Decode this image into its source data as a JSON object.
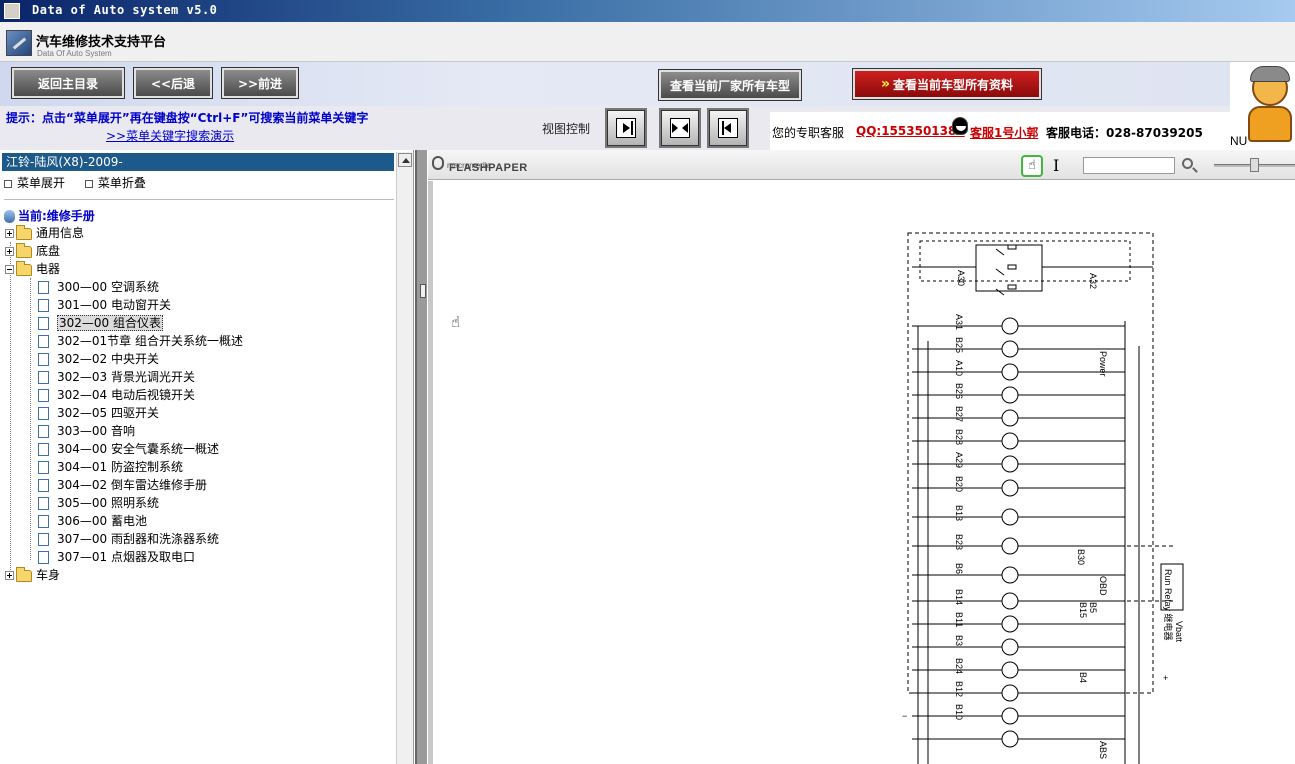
{
  "window": {
    "title": "Data of Auto system v5.0"
  },
  "app": {
    "name": "汽车维修技术支持平台",
    "subtitle": "Data Of Auto System"
  },
  "toolbar": {
    "home": "返回主目录",
    "back": "<<后退",
    "forward": ">>前进",
    "all_models": "查看当前厂家所有车型",
    "all_docs_arrows": "»",
    "all_docs": "查看当前车型所有资料"
  },
  "hint": {
    "text": "提示：点击“菜单展开”再在键盘按“Ctrl+F”可搜索当前菜单关键字",
    "link": ">>菜单关键字搜索演示"
  },
  "view_control": {
    "label": "视图控制"
  },
  "contact": {
    "intro": "您的专职客服",
    "qq": "QQ:1553501388",
    "agent": "客服1号小郭",
    "phone": "客服电话：028-87039205"
  },
  "mascot": {
    "text": "NU"
  },
  "sidebar": {
    "vehicle": "江铃-陆风(X8)-2009-",
    "expand": "菜单展开",
    "collapse": "菜单折叠",
    "current": "当前:维修手册",
    "tree": [
      {
        "label": "通用信息",
        "expanded": false
      },
      {
        "label": "底盘",
        "expanded": false
      },
      {
        "label": "电器",
        "expanded": true
      },
      {
        "label": "车身",
        "expanded": false
      }
    ],
    "electrical_items": [
      "300—00 空调系统",
      "301—00 电动窗开关",
      "302—00 组合仪表",
      "302—01节章  组合开关系统一概述",
      "302—02 中央开关",
      "302—03 背景光调光开关",
      "302—04 电动后视镜开关",
      "302—05 四驱开关",
      "303—00 音响",
      "304—00 安全气囊系统一概述",
      "304—01 防盗控制系统",
      "304—02 倒车雷达维修手册",
      "305—00 照明系统",
      "306—00 蓄电池",
      "307—00 雨刮器和洗涤器系统",
      "307—01 点烟器及取电口"
    ],
    "selected_index": 2
  },
  "viewer": {
    "brand_top": "macromedia",
    "brand_bottom": "FLASHPAPER",
    "hand_icon": "hand-tool-icon",
    "text_cursor_icon": "text-select-icon",
    "search_value": ""
  },
  "diagram": {
    "pins_left": [
      "A30",
      "A31",
      "B25",
      "A10",
      "B26",
      "B27",
      "B28",
      "A29",
      "B20",
      "B13",
      "B23",
      "B6",
      "B14",
      "B11",
      "B3",
      "B24",
      "B12",
      "B10"
    ],
    "pins_right": [
      "A32",
      "B30",
      "B15",
      "B5",
      "B4"
    ],
    "vertical_labels": [
      "Power",
      "OBD",
      "ABS"
    ],
    "relay_label": "Run Relay 继电器",
    "vbatt": "Vbatt",
    "plus": "+",
    "minus": "−"
  }
}
